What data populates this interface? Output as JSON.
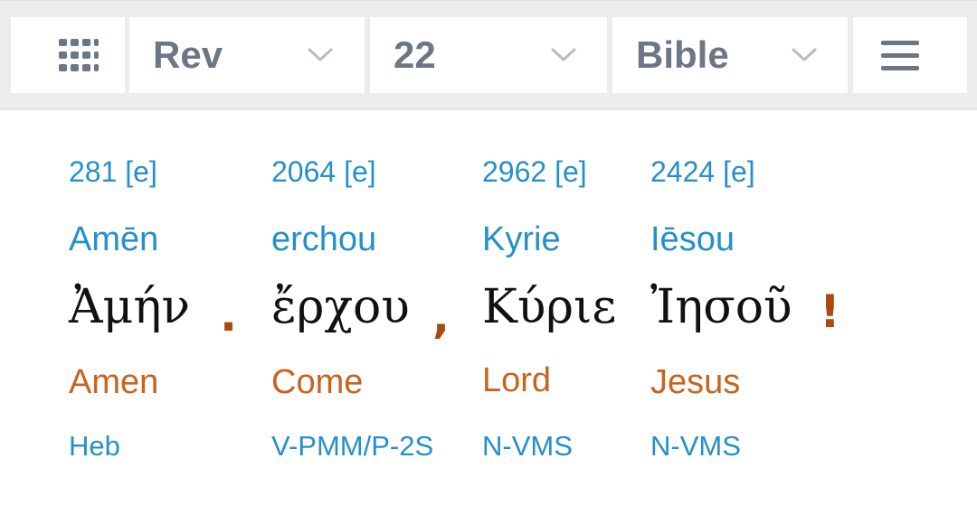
{
  "toolbar": {
    "book": "Rev",
    "chapter": "22",
    "version": "Bible",
    "icons": {
      "grid": "apps-grid-icon",
      "menu": "hamburger-menu-icon",
      "dropdown": "chevron-down-icon"
    }
  },
  "colors": {
    "link_blue": "#2390cc",
    "english_orange": "#c8641e",
    "punct_brown": "#a84a12",
    "greek_text": "#111111",
    "toolbar_text": "#6b7785"
  },
  "interlinear": [
    {
      "strongs": "281 [e]",
      "translit": "Amēn",
      "greek": "Ἀμήν",
      "english": "Amen",
      "parsing": "Heb",
      "punct": "."
    },
    {
      "strongs": "2064 [e]",
      "translit": "erchou",
      "greek": "ἔρχου",
      "english": "Come",
      "parsing": "V-PMM/P-2S",
      "punct": ","
    },
    {
      "strongs": "2962 [e]",
      "translit": "Kyrie",
      "greek": "Κύριε",
      "english": "Lord",
      "parsing": "N-VMS",
      "punct": ""
    },
    {
      "strongs": "2424 [e]",
      "translit": "Iēsou",
      "greek": "Ἰησοῦ",
      "english": "Jesus",
      "parsing": "N-VMS",
      "punct": "!"
    }
  ]
}
